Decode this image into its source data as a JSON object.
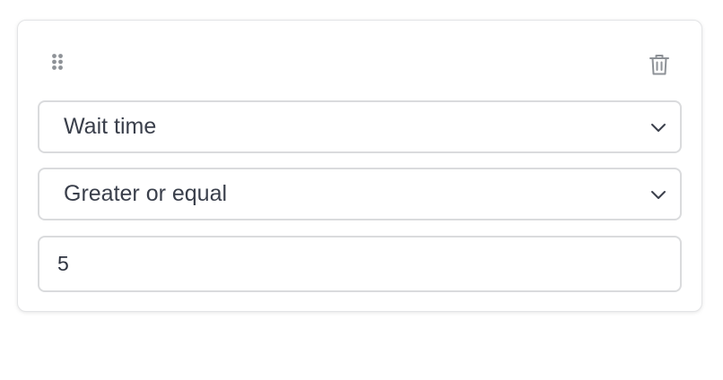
{
  "condition_card": {
    "field_select": {
      "selected": "Wait time"
    },
    "operator_select": {
      "selected": "Greater or equal"
    },
    "value_input": {
      "value": "5"
    },
    "icons": {
      "drag": "drag-handle-icon",
      "delete": "trash-icon",
      "chevron": "chevron-down-icon"
    }
  },
  "colors": {
    "border": "#dadbdd",
    "text": "#3a3f4b",
    "icon": "#8e9297"
  }
}
